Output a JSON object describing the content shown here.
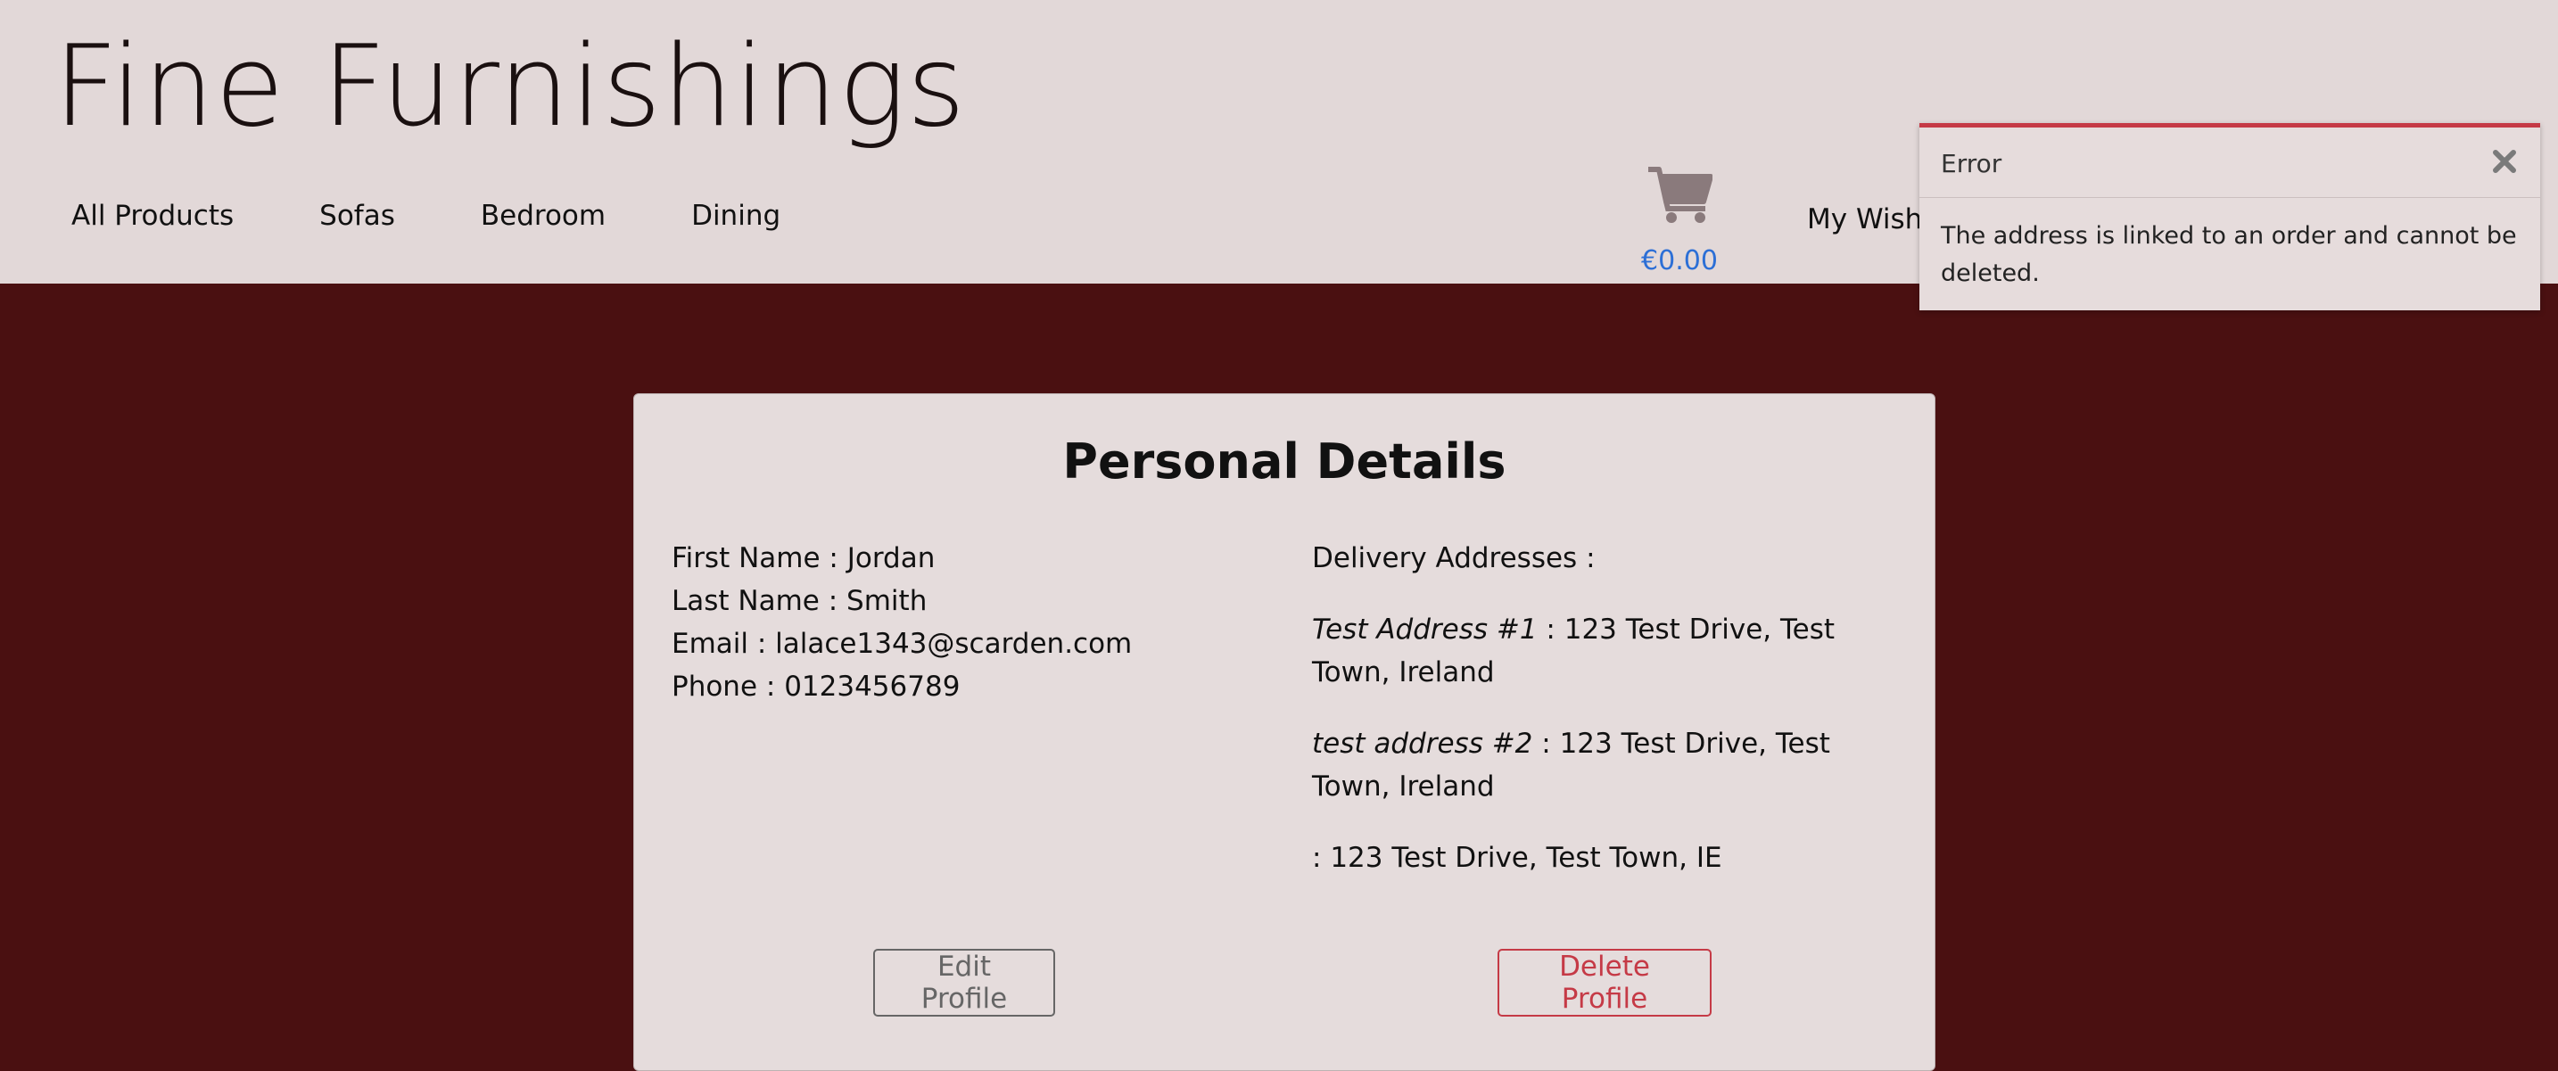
{
  "brand": "Fine Furnishings",
  "nav": {
    "items": [
      "All Products",
      "Sofas",
      "Bedroom",
      "Dining"
    ],
    "wishlist": "My Wishl"
  },
  "cart": {
    "icon": "cart-icon",
    "total": "€0.00"
  },
  "toast": {
    "title": "Error",
    "message": "The address is linked to an order and cannot be deleted.",
    "close_icon": "close-icon",
    "accent": "#c53a46"
  },
  "profile": {
    "title": "Personal Details",
    "fields": [
      {
        "label": "First Name",
        "value": "Jordan"
      },
      {
        "label": "Last Name",
        "value": "Smith"
      },
      {
        "label": "Email",
        "value": "lalace1343@scarden.com"
      },
      {
        "label": "Phone",
        "value": "0123456789"
      }
    ],
    "addresses_label": "Delivery Addresses :",
    "addresses": [
      {
        "name": "Test Address #1",
        "address": "123 Test Drive, Test Town, Ireland"
      },
      {
        "name": "test address #2",
        "address": "123 Test Drive, Test Town, Ireland"
      },
      {
        "name": "",
        "address": "123 Test Drive, Test Town, IE"
      }
    ],
    "edit_label": "Edit Profile",
    "delete_label": "Delete Profile"
  },
  "colors": {
    "header_bg": "#e2d8d8",
    "page_bg": "#4a1011",
    "link": "#2c6fd6"
  }
}
